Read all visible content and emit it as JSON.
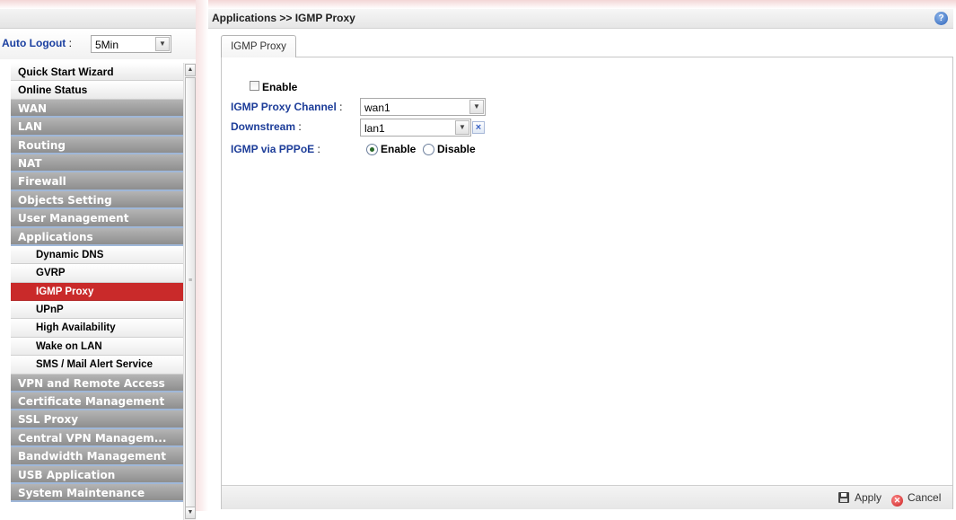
{
  "auto_logout": {
    "label": "Auto Logout",
    "colon": ":",
    "value": "5Min"
  },
  "menu": [
    {
      "label": "Quick Start Wizard",
      "style": "white"
    },
    {
      "label": "Online Status",
      "style": "white"
    },
    {
      "label": "WAN",
      "style": "gray"
    },
    {
      "label": "LAN",
      "style": "gray"
    },
    {
      "label": "Routing",
      "style": "gray"
    },
    {
      "label": "NAT",
      "style": "gray"
    },
    {
      "label": "Firewall",
      "style": "gray"
    },
    {
      "label": "Objects Setting",
      "style": "gray"
    },
    {
      "label": "User Management",
      "style": "gray"
    },
    {
      "label": "Applications",
      "style": "gray"
    },
    {
      "label": "Dynamic DNS",
      "style": "sub"
    },
    {
      "label": "GVRP",
      "style": "sub"
    },
    {
      "label": "IGMP Proxy",
      "style": "active"
    },
    {
      "label": "UPnP",
      "style": "sub"
    },
    {
      "label": "High Availability",
      "style": "sub"
    },
    {
      "label": "Wake on LAN",
      "style": "sub"
    },
    {
      "label": "SMS / Mail Alert Service",
      "style": "sub"
    },
    {
      "label": "VPN and Remote Access",
      "style": "gray"
    },
    {
      "label": "Certificate Management",
      "style": "gray"
    },
    {
      "label": "SSL Proxy",
      "style": "gray"
    },
    {
      "label": "Central VPN Managem...",
      "style": "gray"
    },
    {
      "label": "Bandwidth Management",
      "style": "gray"
    },
    {
      "label": "USB Application",
      "style": "gray"
    },
    {
      "label": "System Maintenance",
      "style": "gray"
    }
  ],
  "breadcrumb": "Applications >> IGMP Proxy",
  "tab_label": "IGMP Proxy",
  "form": {
    "enable_label": "Enable",
    "channel_label": "IGMP Proxy Channel",
    "channel_colon": ":",
    "channel_value": "wan1",
    "downstream_label": "Downstream",
    "downstream_colon": ":",
    "downstream_value": "lan1",
    "pppoe_label": "IGMP via PPPoE",
    "pppoe_colon": ":",
    "pppoe_enable": "Enable",
    "pppoe_disable": "Disable"
  },
  "footer": {
    "apply_label": "Apply",
    "cancel_label": "Cancel"
  },
  "icons": {
    "help": "help-icon",
    "apply": "disk-icon",
    "cancel": "cancel-icon"
  }
}
